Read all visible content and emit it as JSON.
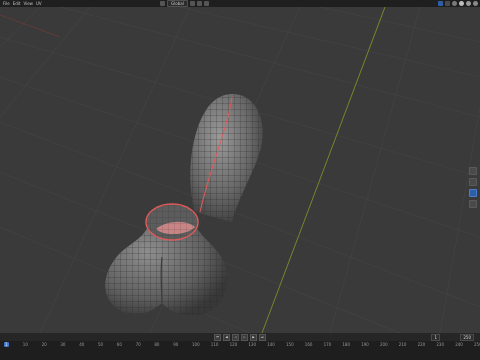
{
  "menu": [
    "File",
    "Edit",
    "View",
    "UV"
  ],
  "header": {
    "shading_dropdown": "Global"
  },
  "timeline": {
    "current_frame": "1",
    "start_frame": "1",
    "end_frame": "250",
    "ticks": [
      "1",
      "10",
      "20",
      "30",
      "40",
      "50",
      "60",
      "70",
      "80",
      "90",
      "100",
      "110",
      "120",
      "130",
      "140",
      "150",
      "160",
      "170",
      "180",
      "190",
      "200",
      "210",
      "220",
      "230",
      "240",
      "250"
    ]
  },
  "colors": {
    "viewport_bg": "#3a3a3a",
    "grid_line": "#454545",
    "mesh_fill": "#6b6b6b",
    "wire": "#2a2a2a",
    "seam": "#e05a5a",
    "x_axis": "#8a3a3a",
    "y_axis": "#7a8a2a",
    "accent": "#3f74c9"
  },
  "icons": {
    "mode_icon": "cube-icon",
    "view_icons": [
      "sphere-icon",
      "sphere-icon",
      "sphere-icon",
      "sphere-icon"
    ],
    "gizmos": [
      "zoom-icon",
      "hand-icon",
      "camera-icon",
      "grid-icon"
    ]
  }
}
